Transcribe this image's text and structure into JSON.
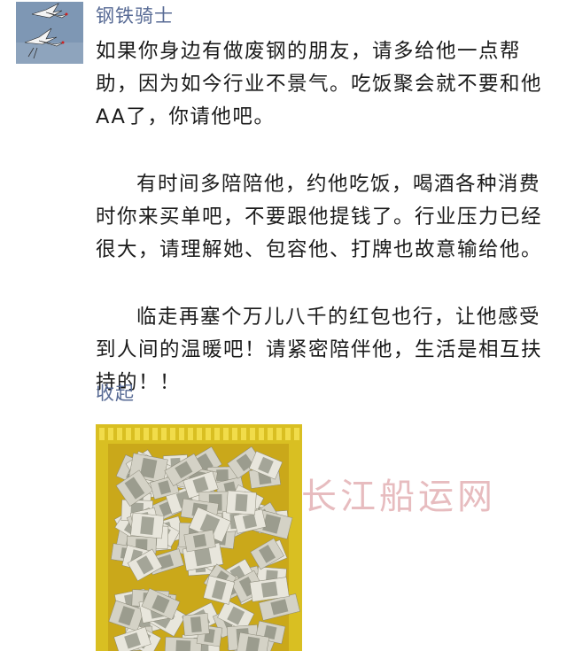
{
  "post": {
    "author": "钢铁骑士",
    "paragraphs": [
      "如果你身边有做废钢的朋友，请多给他一点帮助，因为如今行业不景气。吃饭聚会就不要和他AA了，你请他吧。",
      "有时间多陪陪他，约他吃饭，喝酒各种消费时你来买单吧，不要跟他提钱了。行业压力已经很大，请理解她、包容他、打牌也故意输给他。",
      "临走再塞个万儿八千的红包也行，让他感受到人间的温暖吧！请紧密陪伴他，生活是相互扶持的！！"
    ],
    "collapse_label": "收起"
  },
  "watermark": "长江船运网",
  "colors": {
    "name_link": "#586b95",
    "text": "#1b1b1b",
    "crate": "#e2c627",
    "watermark": "#e3b1b4"
  },
  "icons": {
    "avatar": "two-cranes-avatar",
    "photo": "crate-of-banknotes-photo"
  }
}
